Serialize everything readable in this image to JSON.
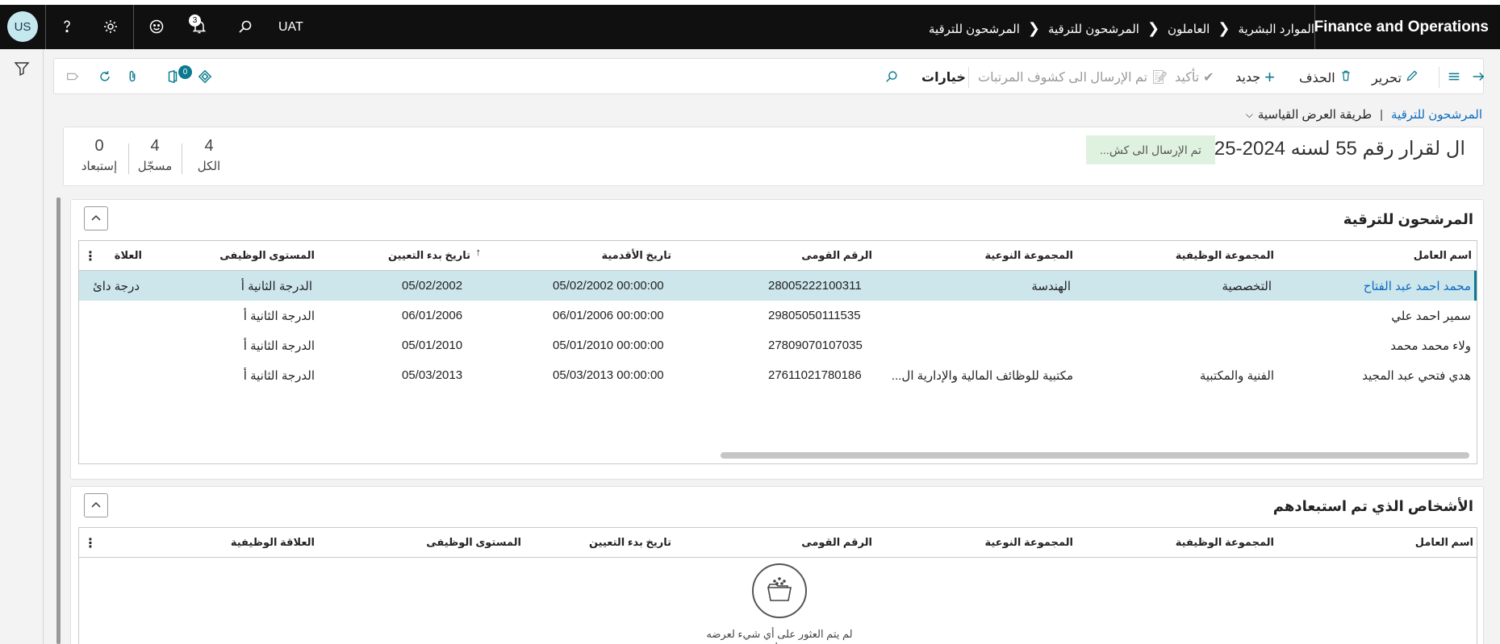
{
  "topbar": {
    "avatar": "US",
    "notifications_count": "3",
    "environment": "UAT",
    "breadcrumbs": [
      "الموارد البشرية",
      "العاملون",
      "المرشحون للترقية",
      "المرشحون للترقية"
    ],
    "app_name": "Finance and Operations"
  },
  "actions": {
    "edit": "تحرير",
    "delete": "الحذف",
    "new": "جديد",
    "confirm": "تأكيد",
    "sent_to_payroll": "تم الإرسال الى كشوف المرتبات",
    "options": "خيارات",
    "attachments_count": "0"
  },
  "view": {
    "page_link": "المرشحون للترقية",
    "view_name": "طريقة العرض القياسية"
  },
  "header": {
    "title": "ال لقرار رقم 55 لسنه 2024-2025",
    "status": "تم الإرسال الى كش...",
    "kpis": [
      {
        "value": "4",
        "label": "الكل"
      },
      {
        "value": "4",
        "label": "مسجّل"
      },
      {
        "value": "0",
        "label": "إستبعاد"
      }
    ]
  },
  "candidates": {
    "title": "المرشحون للترقية",
    "columns": {
      "worker_name": "اسم العامل",
      "job_group": "المجموعة الوظيفية",
      "type_group": "المجموعة النوعية",
      "national_id": "الرقم القومى",
      "seniority_date": "تاريخ الأقدمية",
      "hire_start_date": "تاريخ بدء التعيين",
      "job_level": "المستوى الوظيفى",
      "relation": "العلاة"
    },
    "rows": [
      {
        "worker_name": "محمد احمد عبد الفتاح",
        "job_group": "التخصصية",
        "type_group": "الهندسة",
        "national_id": "28005222100311",
        "seniority_date": "05/02/2002 00:00:00",
        "hire_start_date": "05/02/2002",
        "job_level": "الدرجة الثانية أ",
        "relation": "درجة دائ"
      },
      {
        "worker_name": "سمير احمد علي",
        "job_group": "",
        "type_group": "",
        "national_id": "29805050111535",
        "seniority_date": "06/01/2006 00:00:00",
        "hire_start_date": "06/01/2006",
        "job_level": "الدرجة الثانية أ",
        "relation": ""
      },
      {
        "worker_name": "ولاء محمد محمد",
        "job_group": "",
        "type_group": "",
        "national_id": "27809070107035",
        "seniority_date": "05/01/2010 00:00:00",
        "hire_start_date": "05/01/2010",
        "job_level": "الدرجة الثانية أ",
        "relation": ""
      },
      {
        "worker_name": "هدي فتحي عبد المجيد",
        "job_group": "الفنية والمكتبية",
        "type_group": "مكتبية للوظائف المالية والإدارية ال...",
        "national_id": "27611021780186",
        "seniority_date": "05/03/2013 00:00:00",
        "hire_start_date": "05/03/2013",
        "job_level": "الدرجة الثانية أ",
        "relation": ""
      }
    ]
  },
  "excluded": {
    "title": "الأشخاص الذي تم استبعادهم",
    "columns": {
      "worker_name": "اسم العامل",
      "job_group": "المجموعة الوظيفية",
      "type_group": "المجموعة النوعية",
      "national_id": "الرقم القومى",
      "hire_start_date": "تاريخ بدء التعيين",
      "job_level": "المستوى الوظيفى",
      "job_relation": "العلاقة الوظيفية"
    },
    "empty_message": "لم يتم العثور على أي شيء لعرضه هنا."
  }
}
